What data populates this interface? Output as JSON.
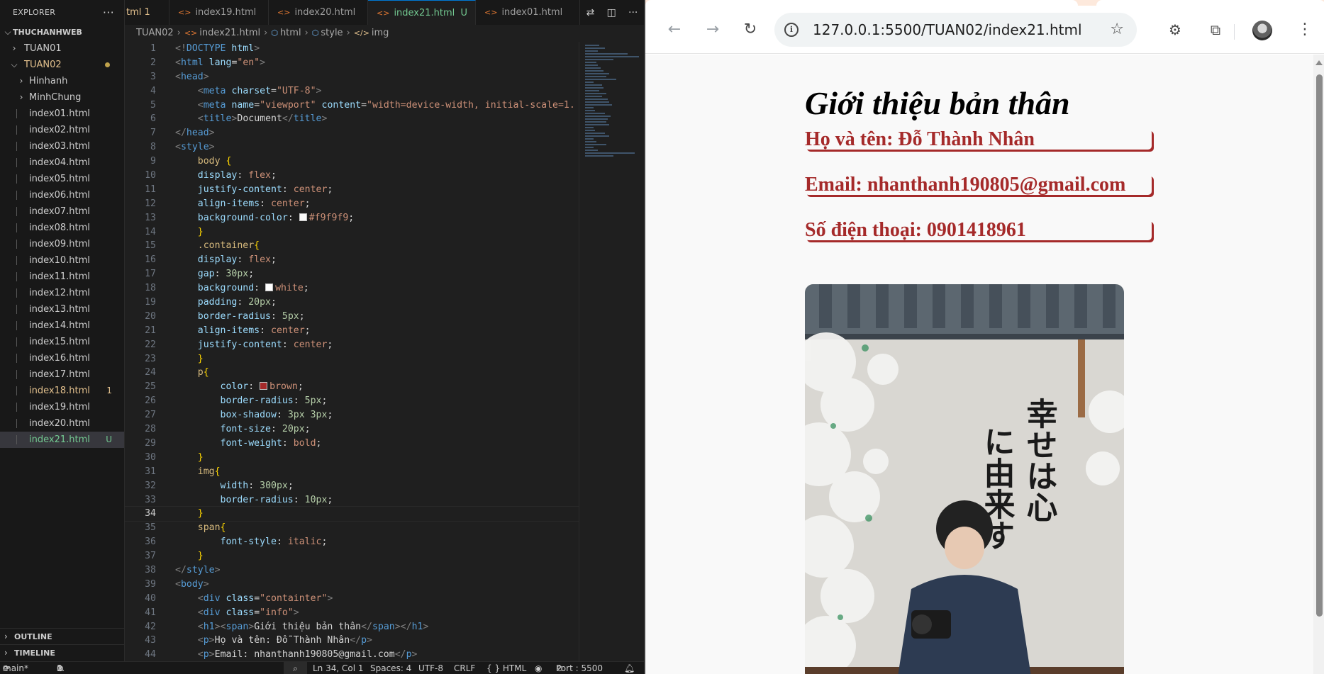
{
  "explorer": {
    "title": "EXPLORER",
    "workspace": "THUCHANHWEB",
    "folders": [
      "TUAN01",
      "TUAN02"
    ],
    "subfolders": [
      "Hinhanh",
      "MinhChung"
    ],
    "files": [
      {
        "name": "index01.html",
        "state": ""
      },
      {
        "name": "index02.html",
        "state": ""
      },
      {
        "name": "index03.html",
        "state": ""
      },
      {
        "name": "index04.html",
        "state": ""
      },
      {
        "name": "index05.html",
        "state": ""
      },
      {
        "name": "index06.html",
        "state": ""
      },
      {
        "name": "index07.html",
        "state": ""
      },
      {
        "name": "index08.html",
        "state": ""
      },
      {
        "name": "index09.html",
        "state": ""
      },
      {
        "name": "index10.html",
        "state": ""
      },
      {
        "name": "index11.html",
        "state": ""
      },
      {
        "name": "index12.html",
        "state": ""
      },
      {
        "name": "index13.html",
        "state": ""
      },
      {
        "name": "index14.html",
        "state": ""
      },
      {
        "name": "index15.html",
        "state": ""
      },
      {
        "name": "index16.html",
        "state": ""
      },
      {
        "name": "index17.html",
        "state": ""
      },
      {
        "name": "index18.html",
        "state": "1"
      },
      {
        "name": "index19.html",
        "state": ""
      },
      {
        "name": "index20.html",
        "state": ""
      },
      {
        "name": "index21.html",
        "state": "U"
      }
    ],
    "outline": "OUTLINE",
    "timeline": "TIMELINE"
  },
  "tabs": [
    {
      "label": "tml 1"
    },
    {
      "label": "index19.html"
    },
    {
      "label": "index20.html"
    },
    {
      "label": "index21.html",
      "badge": "U"
    },
    {
      "label": "index01.html"
    }
  ],
  "breadcrumb": [
    "TUAN02",
    "index21.html",
    "html",
    "style",
    "img"
  ],
  "status": {
    "branch": "main*",
    "problems": "0",
    "warnings": "1",
    "position": "Ln 34, Col 1",
    "spaces": "Spaces: 4",
    "encoding": "UTF-8",
    "eol": "CRLF",
    "language": "{ } HTML",
    "port": "Port : 5500"
  },
  "browser": {
    "url": "127.0.0.1:5500/TUAN02/index21.html"
  },
  "webpage": {
    "heading": "Giới thiệu bản thân",
    "paragraphs": [
      "Họ và tên: Đỗ Thành Nhân",
      "Email: nhanthanh190805@gmail.com",
      "Số điện thoại: 0901418961"
    ],
    "photo_sign": [
      "幸せは心",
      "に由来す"
    ]
  },
  "colors": {
    "accent": "#0078d4",
    "modified": "#e2c08d",
    "untracked": "#73c991",
    "web_text": "#a52a2a"
  }
}
